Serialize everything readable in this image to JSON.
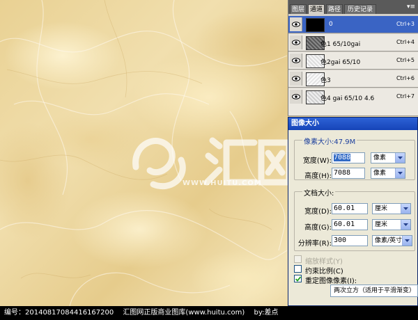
{
  "channels_panel": {
    "tabs": [
      "图层",
      "通道",
      "路径",
      "历史记录"
    ],
    "active_tab": "通道",
    "rows": [
      {
        "name": "0",
        "shortcut": "Ctrl+3",
        "selected": true
      },
      {
        "name": "色1 65/10gai",
        "shortcut": "Ctrl+4",
        "selected": false
      },
      {
        "name": "色2gai 65/10",
        "shortcut": "Ctrl+5",
        "selected": false
      },
      {
        "name": "色3",
        "shortcut": "Ctrl+6",
        "selected": false
      },
      {
        "name": "色4 gai 65/10 4.6",
        "shortcut": "Ctrl+7",
        "selected": false
      }
    ]
  },
  "dialog": {
    "title": "图像大小",
    "pixel_dimensions_label": "像素大小:47.9M",
    "width_label": "宽度(W):",
    "width_value": "7088",
    "width_unit": "像素",
    "height_label": "高度(H):",
    "height_value": "7088",
    "height_unit": "像素",
    "document_size_label": "文档大小:",
    "doc_width_label": "宽度(D):",
    "doc_width_value": "60.01",
    "doc_width_unit": "厘米",
    "doc_height_label": "高度(G):",
    "doc_height_value": "60.01",
    "doc_height_unit": "厘米",
    "resolution_label": "分辨率(R):",
    "resolution_value": "300",
    "resolution_unit": "像素/英寸",
    "scale_styles_label": "缩放样式(Y)",
    "constrain_label": "约束比例(C)",
    "resample_label": "重定图像像素(I):",
    "resample_method": "两次立方（适用于平滑渐变）"
  },
  "watermark": {
    "text": "WWW.HUITU.COM"
  },
  "footer": {
    "id_text": "编号：20140817084416167200",
    "site_text": "汇图网正版商业图库(www.huitu.com)",
    "author_text": "by:差点"
  },
  "colors": {
    "selected_row": "#3a64c4",
    "title_bar": "#1644b8",
    "marble": "#ecd79f"
  }
}
